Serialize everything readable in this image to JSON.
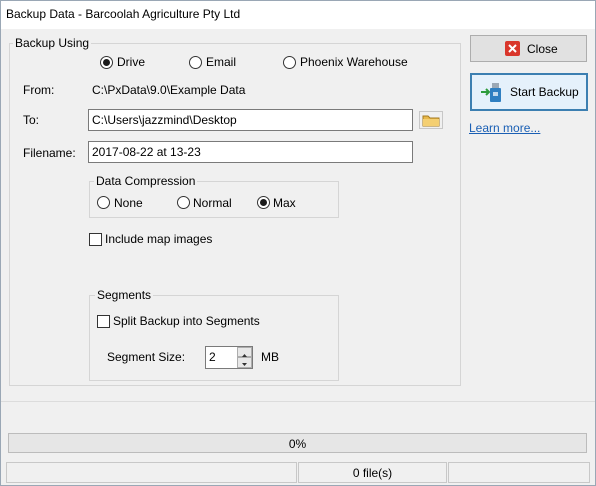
{
  "window": {
    "title": "Backup Data - Barcoolah Agriculture Pty Ltd"
  },
  "backup_using": {
    "label": "Backup Using",
    "options": [
      {
        "label": "Drive",
        "selected": true
      },
      {
        "label": "Email",
        "selected": false
      },
      {
        "label": "Phoenix Warehouse",
        "selected": false
      }
    ]
  },
  "form": {
    "from_label": "From:",
    "from_value": "C:\\PxData\\9.0\\Example Data",
    "to_label": "To:",
    "to_value": "C:\\Users\\jazzmind\\Desktop",
    "filename_label": "Filename:",
    "filename_value": "2017-08-22 at 13-23"
  },
  "compression": {
    "label": "Data Compression",
    "options": [
      {
        "label": "None",
        "selected": false
      },
      {
        "label": "Normal",
        "selected": false
      },
      {
        "label": "Max",
        "selected": true
      }
    ]
  },
  "include_map": {
    "label": "Include map images",
    "checked": false
  },
  "segments": {
    "label": "Segments",
    "split_label": "Split Backup into Segments",
    "split_checked": false,
    "size_label": "Segment Size:",
    "size_value": "2",
    "unit": "MB"
  },
  "actions": {
    "close_label": "Close",
    "start_label": "Start Backup",
    "learn_more": "Learn more..."
  },
  "status": {
    "progress": 0,
    "progress_text": "0%",
    "files_text": "0 file(s)"
  },
  "colors": {
    "close_icon": "#d9362b",
    "link": "#1a5fb4",
    "folder": "#e8b84a"
  }
}
